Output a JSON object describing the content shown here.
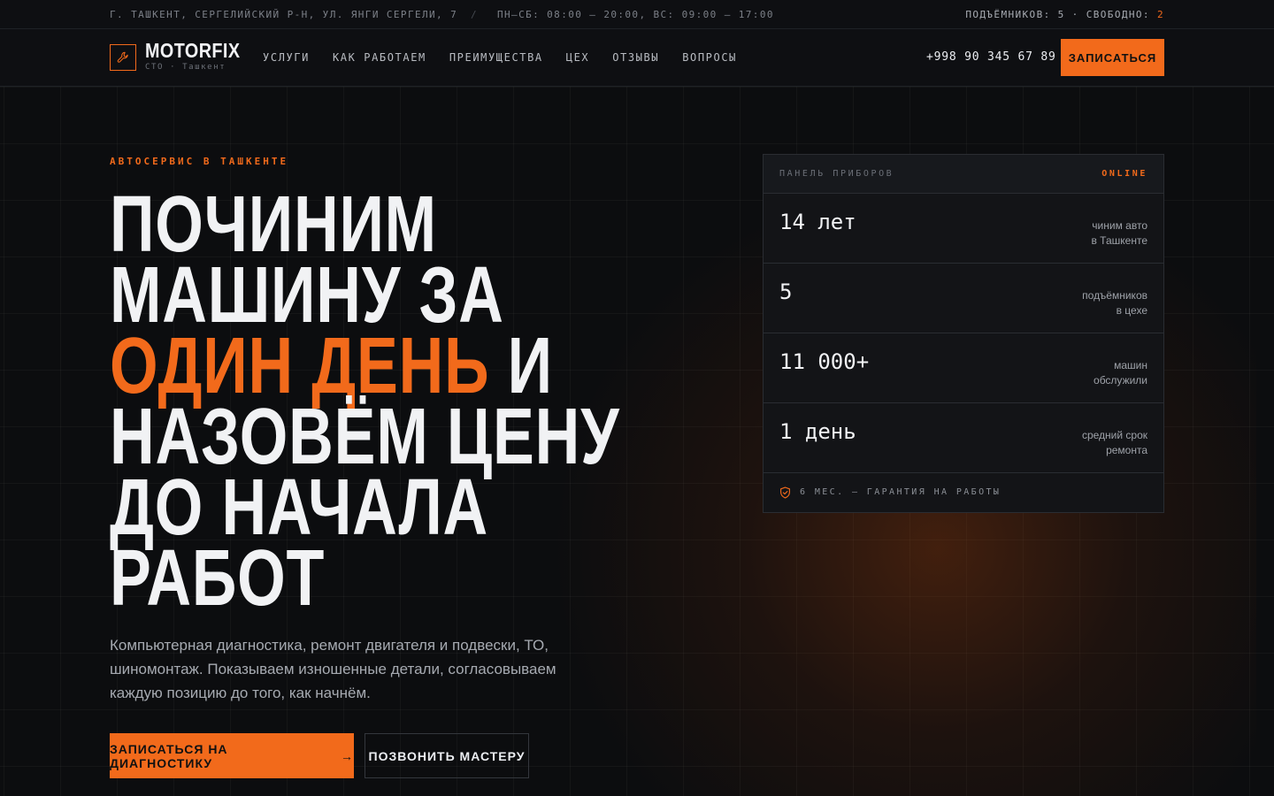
{
  "topbar": {
    "address": "Г. ТАШКЕНТ, СЕРГЕЛИЙСКИЙ Р-Н, УЛ. ЯНГИ СЕРГЕЛИ, 7",
    "separator": "/",
    "hours": "ПН–СБ: 08:00 – 20:00, ВС: 09:00 – 17:00",
    "lifts_label": "ПОДЪЁМНИКОВ: 5 · СВОБОДНО:",
    "lifts_free": "2"
  },
  "header": {
    "brand": "MOTORFIX",
    "brand_sub": "СТО · Ташкент",
    "logo_icon": "wrench-icon",
    "nav": [
      "УСЛУГИ",
      "КАК РАБОТАЕМ",
      "ПРЕИМУЩЕСТВА",
      "ЦЕХ",
      "ОТЗЫВЫ",
      "ВОПРОСЫ"
    ],
    "phone": "+998 90 345 67 89",
    "cta": "ЗАПИСАТЬСЯ"
  },
  "hero": {
    "eyebrow": "АВТОСЕРВИС В ТАШКЕНТЕ",
    "headline": {
      "line1": "ПОЧИНИМ",
      "line2": "МАШИНУ ЗА",
      "line3_accent": "ОДИН ДЕНЬ",
      "line3_rest": " И",
      "line4": "НАЗОВЁМ ЦЕНУ",
      "line5": "ДО НАЧАЛА",
      "line6": "РАБОТ"
    },
    "lead": "Компьютерная диагностика, ремонт двигателя и подвески, ТО, шиномонтаж. Показываем изношенные детали, согласовываем каждую позицию до того, как начнём.",
    "primary_button": "ЗАПИСАТЬСЯ НА ДИАГНОСТИКУ",
    "primary_arrow": "→",
    "secondary_button": "ПОЗВОНИТЬ МАСТЕРУ"
  },
  "panel": {
    "title": "ПАНЕЛЬ ПРИБОРОВ",
    "status": "ONLINE",
    "stats": [
      {
        "value": "14 лет",
        "label": "чиним авто\nв Ташкенте"
      },
      {
        "value": "5",
        "label": "подъёмников\nв цехе"
      },
      {
        "value": "11 000+",
        "label": "машин\nобслужили"
      },
      {
        "value": "1 день",
        "label": "средний срок\nремонта"
      }
    ],
    "footer": "6 МЕС. — ГАРАНТИЯ НА РАБОТЫ",
    "footer_icon": "shield-icon"
  },
  "colors": {
    "accent": "#f26a1b",
    "background": "#0c0d0f",
    "text": "#f1f2f4"
  }
}
